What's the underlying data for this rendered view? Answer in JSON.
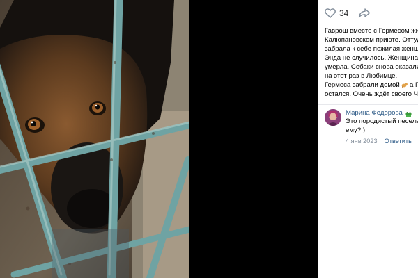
{
  "post": {
    "likes_count": "34",
    "caption_lines": [
      "Гаврош вместе с Гермесом жил",
      "Калюпановском приюте. Оттуд",
      "забрала к себе пожилая женщ",
      "Энда не случилось. Женщина з",
      "умерла. Собаки снова оказали",
      "на этот раз в Любимце."
    ],
    "caption_last_before_emoji": "Гермеса забрали домой",
    "caption_last_after_emoji": " а Г",
    "caption_final_line": "остался. Очень ждёт своего Че"
  },
  "comment": {
    "author": "Марина Федорова",
    "text_line_1": "Это породистый песель",
    "text_line_2": "ему? )",
    "date": "4 янв 2023",
    "reply_label": "Ответить"
  },
  "icons": {
    "like": "heart-icon",
    "share": "share-arrow-icon",
    "author_badge": "gift-badge-icon",
    "caption_emoji": "dog-emoji-icon"
  },
  "colors": {
    "link": "#2a5885",
    "muted": "#818c99",
    "badge": "#4bb34b"
  }
}
